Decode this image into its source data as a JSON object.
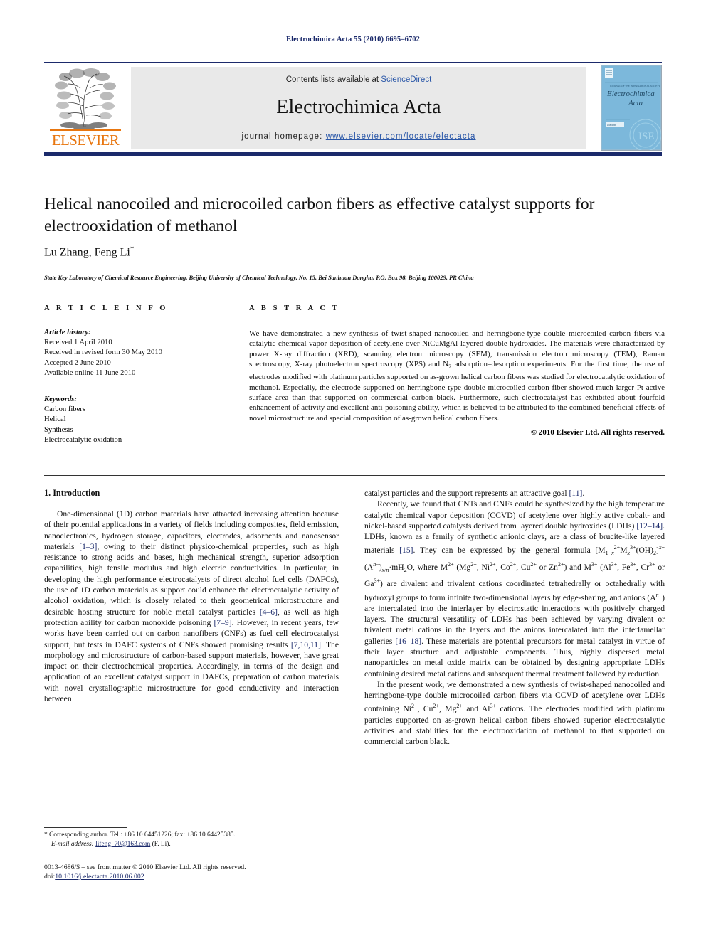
{
  "running_head": "Electrochimica Acta 55 (2010) 6695–6702",
  "masthead": {
    "contents_prefix": "Contents lists available at ",
    "sciencedirect": "ScienceDirect",
    "journal_name": "Electrochimica Acta",
    "homepage_prefix": "journal homepage: ",
    "homepage_url": "www.elsevier.com/locate/electacta",
    "publisher_wordmark": "ELSEVIER",
    "cover_title_line1": "Electrochimica",
    "cover_title_line2": "Acta",
    "colors": {
      "rule": "#1b2a6b",
      "link": "#2a57a8",
      "elsevier_orange": "#e8760f",
      "banner_bg": "#e9e9e9",
      "cover_bg": "#74b3d8"
    }
  },
  "article": {
    "title": "Helical nanocoiled and microcoiled carbon fibers as effective catalyst supports for electrooxidation of methanol",
    "authors": "Lu Zhang, Feng Li",
    "author_marker": "*",
    "affiliation": "State Key Laboratory of Chemical Resource Engineering, Beijing University of Chemical Technology, No. 15, Bei Sanhuan Donghu, P.O. Box 98, Beijing 100029, PR China"
  },
  "article_info": {
    "heading": "A R T I C L E    I N F O",
    "history_label": "Article history:",
    "history": [
      "Received 1 April 2010",
      "Received in revised form 30 May 2010",
      "Accepted 2 June 2010",
      "Available online 11 June 2010"
    ],
    "keywords_label": "Keywords:",
    "keywords": [
      "Carbon fibers",
      "Helical",
      "Synthesis",
      "Electrocatalytic oxidation"
    ]
  },
  "abstract": {
    "heading": "A B S T R A C T",
    "text": "We have demonstrated a new synthesis of twist-shaped nanocoiled and herringbone-type double microcoiled carbon fibers via catalytic chemical vapor deposition of acetylene over NiCuMgAl-layered double hydroxides. The materials were characterized by power X-ray diffraction (XRD), scanning electron microscopy (SEM), transmission electron microscopy (TEM), Raman spectroscopy, X-ray photoelectron spectroscopy (XPS) and N2 adsorption–desorption experiments. For the first time, the use of electrodes modified with platinum particles supported on as-grown helical carbon fibers was studied for electrocatalytic oxidation of methanol. Especially, the electrode supported on herringbone-type double microcoiled carbon fiber showed much larger Pt active surface area than that supported on commercial carbon black. Furthermore, such electrocatalyst has exhibited about fourfold enhancement of activity and excellent anti-poisoning ability, which is believed to be attributed to the combined beneficial effects of novel microstructure and special composition of as-grown helical carbon fibers.",
    "copyright": "© 2010 Elsevier Ltd. All rights reserved."
  },
  "introduction": {
    "heading": "1.  Introduction",
    "left_paragraph_1": "One-dimensional (1D) carbon materials have attracted increasing attention because of their potential applications in a variety of fields including composites, field emission, nanoelectronics, hydrogen storage, capacitors, electrodes, adsorbents and nanosensor materials [1–3], owing to their distinct physico-chemical properties, such as high resistance to strong acids and bases, high mechanical strength, superior adsorption capabilities, high tensile modulus and high electric conductivities. In particular, in developing the high performance electrocatalysts of direct alcohol fuel cells (DAFCs), the use of 1D carbon materials as support could enhance the electrocatalytic activity of alcohol oxidation, which is closely related to their geometrical microstructure and desirable hosting structure for noble metal catalyst particles [4–6], as well as high protection ability for carbon monoxide poisoning [7–9]. However, in recent years, few works have been carried out on carbon nanofibers (CNFs) as fuel cell electrocatalyst support, but tests in DAFC systems of CNFs showed promising results [7,10,11]. The morphology and microstructure of carbon-based support materials, however, have great impact on their electrochemical properties. Accordingly, in terms of the design and application of an excellent catalyst support in DAFCs, preparation of carbon materials with novel crystallographic microstructure for good conductivity and interaction between",
    "right_paragraph_1_tail": "catalyst particles and the support represents an attractive goal [11].",
    "right_paragraph_2": "Recently, we found that CNTs and CNFs could be synthesized by the high temperature catalytic chemical vapor deposition (CCVD) of acetylene over highly active cobalt- and nickel-based supported catalysts derived from layered double hydroxides (LDHs) [12–14]. LDHs, known as a family of synthetic anionic clays, are a class of brucite-like layered materials [15]. They can be expressed by the general formula [M1−x2+Mx3+(OH)2]x+(An−)x/n·mH2O, where M2+ (Mg2+, Ni2+, Co2+, Cu2+ or Zn2+) and M3+ (Al3+, Fe3+, Cr3+ or Ga3+) are divalent and trivalent cations coordinated tetrahedrally or octahedrally with hydroxyl groups to form infinite two-dimensional layers by edge-sharing, and anions (An−) are intercalated into the interlayer by electrostatic interactions with positively charged layers. The structural versatility of LDHs has been achieved by varying divalent or trivalent metal cations in the layers and the anions intercalated into the interlamellar galleries [16–18]. These materials are potential precursors for metal catalyst in virtue of their layer structure and adjustable components. Thus, highly dispersed metal nanoparticles on metal oxide matrix can be obtained by designing appropriate LDHs containing desired metal cations and subsequent thermal treatment followed by reduction.",
    "right_paragraph_3": "In the present work, we demonstrated a new synthesis of twist-shaped nanocoiled and herringbone-type double microcoiled carbon fibers via CCVD of acetylene over LDHs containing Ni2+, Cu2+, Mg2+ and Al3+ cations. The electrodes modified with platinum particles supported on as-grown helical carbon fibers showed superior electrocatalytic activities and stabilities for the electrooxidation of methanol to that supported on commercial carbon black."
  },
  "footnotes": {
    "corresponding": "* Corresponding author. Tel.: +86 10 64451226; fax: +86 10 64425385.",
    "email_label": "E-mail address:",
    "email": "lifeng_70@163.com",
    "email_suffix": "(F. Li).",
    "imprint_line1": "0013-4686/$ – see front matter © 2010 Elsevier Ltd. All rights reserved.",
    "doi_label": "doi:",
    "doi_value": "10.1016/j.electacta.2010.06.002"
  }
}
